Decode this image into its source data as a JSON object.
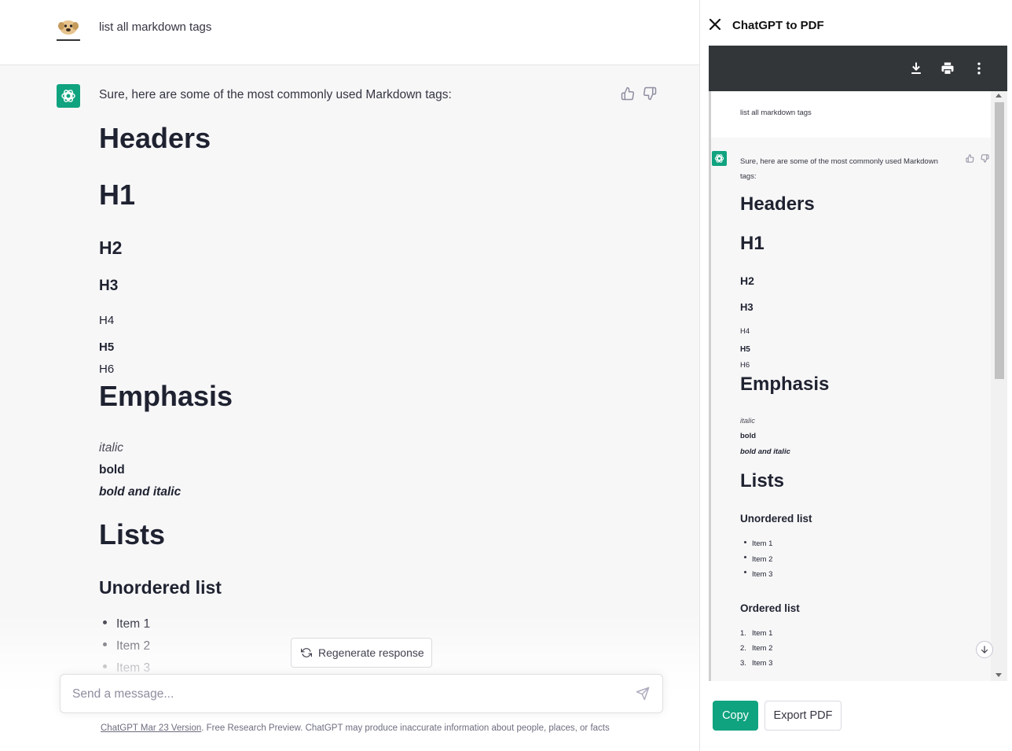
{
  "conversation": {
    "user_message": "list all markdown tags",
    "assistant": {
      "intro": "Sure, here are some of the most commonly used Markdown tags:",
      "headers_title": "Headers",
      "h1": "H1",
      "h2": "H2",
      "h3": "H3",
      "h4": "H4",
      "h5": "H5",
      "h6": "H6",
      "emphasis_title": "Emphasis",
      "italic": "italic",
      "bold": "bold",
      "bold_italic": "bold and italic",
      "lists_title": "Lists",
      "unordered_title": "Unordered list",
      "unordered_items": [
        "Item 1",
        "Item 2",
        "Item 3"
      ],
      "ordered_title": "Ordered list",
      "ordered_items": [
        "Item 1",
        "Item 2",
        "Item 3"
      ],
      "ordered_numbers": [
        "1.",
        "2.",
        "3."
      ]
    }
  },
  "composer": {
    "placeholder": "Send a message...",
    "regenerate_label": "Regenerate response"
  },
  "footer": {
    "version_link": "ChatGPT Mar 23 Version",
    "disclaimer": ". Free Research Preview. ChatGPT may produce inaccurate information about people, places, or facts"
  },
  "panel": {
    "title": "ChatGPT to PDF",
    "copy_label": "Copy",
    "export_label": "Export PDF"
  },
  "colors": {
    "accent": "#10a37f",
    "viewer_toolbar": "#323639"
  },
  "icons": [
    "user-avatar-icon",
    "openai-logo-icon",
    "thumbs-up-icon",
    "thumbs-down-icon",
    "refresh-icon",
    "send-icon",
    "close-icon",
    "download-icon",
    "print-icon",
    "more-vert-icon",
    "arrow-down-icon"
  ]
}
